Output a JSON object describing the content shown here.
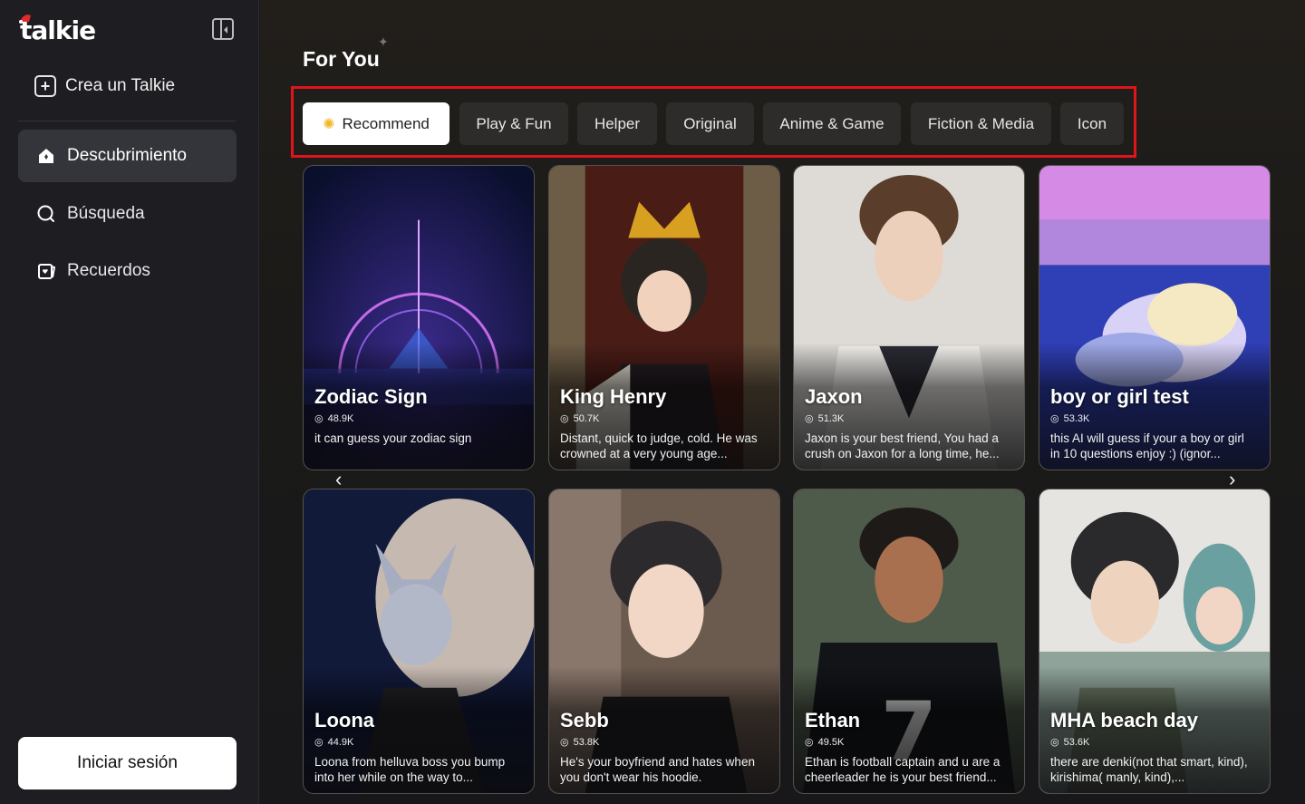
{
  "sidebar": {
    "brand": "talkie",
    "create_label": "Crea un Talkie",
    "nav": [
      {
        "label": "Descubrimiento",
        "icon": "home-icon",
        "active": true
      },
      {
        "label": "Búsqueda",
        "icon": "search-icon",
        "active": false
      },
      {
        "label": "Recuerdos",
        "icon": "memories-icon",
        "active": false
      }
    ],
    "login_label": "Iniciar sesión"
  },
  "main": {
    "section_title": "For You",
    "tabs": [
      {
        "label": "Recommend",
        "active": true,
        "icon": "sun-icon"
      },
      {
        "label": "Play & Fun",
        "active": false
      },
      {
        "label": "Helper",
        "active": false
      },
      {
        "label": "Original",
        "active": false
      },
      {
        "label": "Anime & Game",
        "active": false
      },
      {
        "label": "Fiction & Media",
        "active": false
      },
      {
        "label": "Icon",
        "active": false
      }
    ],
    "cards": [
      {
        "name": "Zodiac Sign",
        "count": "48.9K",
        "desc": "it can guess your zodiac sign"
      },
      {
        "name": "King Henry",
        "count": "50.7K",
        "desc": "Distant, quick to judge, cold. He was crowned at a very young age..."
      },
      {
        "name": "Jaxon",
        "count": "51.3K",
        "desc": "Jaxon is your best friend, You had a crush on Jaxon for a long time, he..."
      },
      {
        "name": "boy or girl test",
        "count": "53.3K",
        "desc": "this AI will guess if your a boy or girl in 10 questions enjoy :) (ignor..."
      },
      {
        "name": "Loona",
        "count": "44.9K",
        "desc": "Loona from helluva boss you bump into her while on the way to..."
      },
      {
        "name": "Sebb",
        "count": "53.8K",
        "desc": "He's your boyfriend and hates when you don't wear his hoodie."
      },
      {
        "name": "Ethan",
        "count": "49.5K",
        "desc": "Ethan is football captain and u are a cheerleader he is your best friend..."
      },
      {
        "name": "MHA beach day",
        "count": "53.6K",
        "desc": "there are denki(not that smart, kind), kirishima( manly, kind),..."
      }
    ]
  },
  "colors": {
    "highlight_border": "#e0141b",
    "accent_sun": "#f3b624",
    "sidebar_bg": "#1d1d22"
  }
}
